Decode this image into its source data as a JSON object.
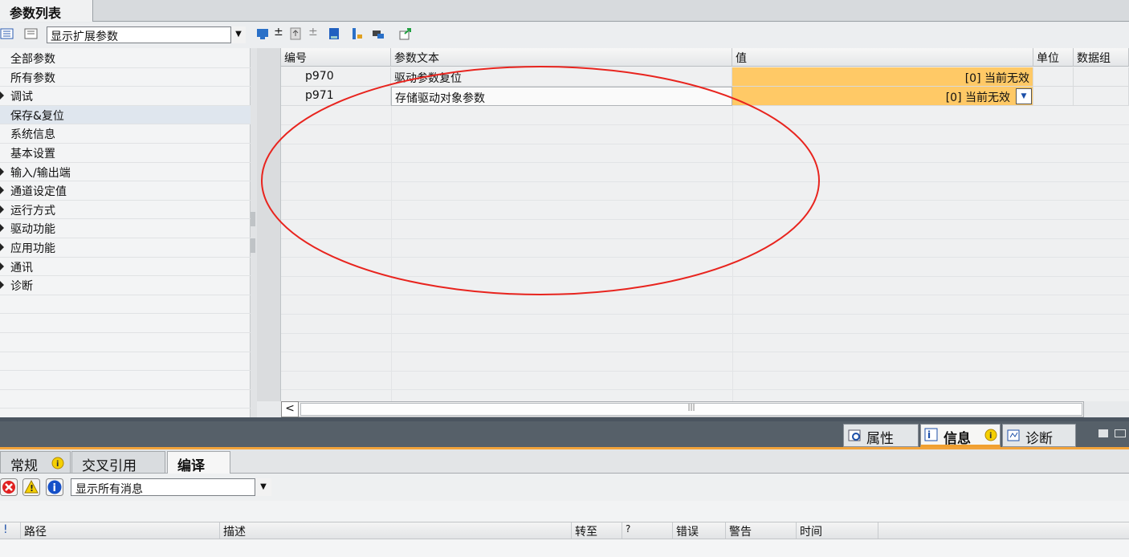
{
  "editor_tab": "参数列表",
  "filter_value": "显示扩展参数",
  "nav_items": [
    {
      "label": "全部参数",
      "arrow": false
    },
    {
      "label": "所有参数",
      "arrow": false
    },
    {
      "label": "调试",
      "arrow": true
    },
    {
      "label": "保存&复位",
      "arrow": false
    },
    {
      "label": "系统信息",
      "arrow": false
    },
    {
      "label": "基本设置",
      "arrow": false
    },
    {
      "label": "输入/输出端",
      "arrow": true
    },
    {
      "label": "通道设定值",
      "arrow": true
    },
    {
      "label": "运行方式",
      "arrow": true
    },
    {
      "label": "驱动功能",
      "arrow": true
    },
    {
      "label": "应用功能",
      "arrow": true
    },
    {
      "label": "通讯",
      "arrow": true
    },
    {
      "label": "诊断",
      "arrow": true
    }
  ],
  "grid": {
    "headers": {
      "number": "编号",
      "text": "参数文本",
      "value": "值",
      "unit": "单位",
      "dataset": "数据组"
    },
    "rows": [
      {
        "number": "p970",
        "text": "驱动参数复位",
        "value": "[0] 当前无效"
      },
      {
        "number": "p971",
        "text": "存储驱动对象参数",
        "value": "[0] 当前无效"
      }
    ],
    "scroll_thumb": "|||"
  },
  "inspector_tabs": {
    "properties": "属性",
    "info": "信息",
    "diagnostics": "诊断"
  },
  "sub_tabs": {
    "general": "常规",
    "cross_reference": "交叉引用",
    "compile": "编译"
  },
  "message_filter": "显示所有消息",
  "message_headers": {
    "status": "!",
    "path": "路径",
    "description": "描述",
    "goto": "转至",
    "q": "?",
    "errors": "错误",
    "warnings": "警告",
    "time": "时间"
  },
  "colors": {
    "value_cell": "#ffc966",
    "annotation_circle": "#e8241e",
    "inspector_accent": "#f2a33a"
  }
}
